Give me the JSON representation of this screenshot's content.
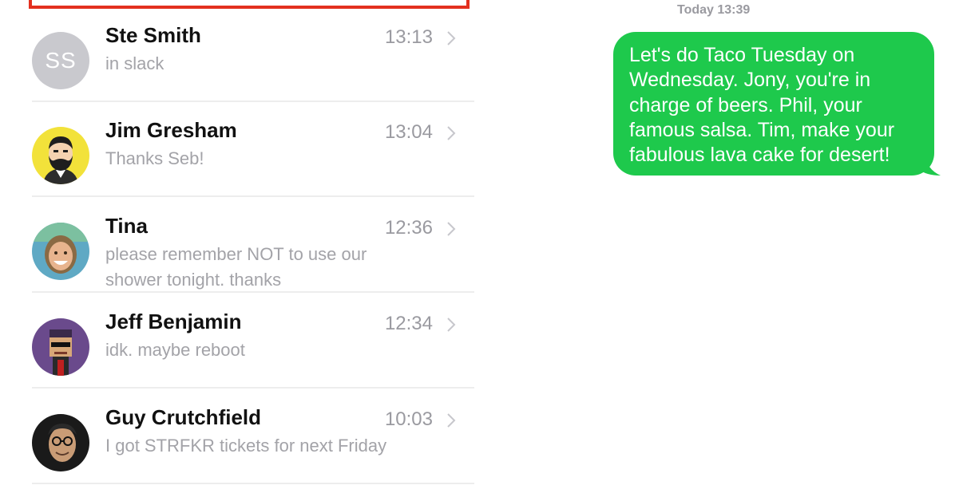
{
  "conversations": [
    {
      "name": "Ste Smith",
      "time": "13:13",
      "preview": "in slack",
      "avatar": {
        "type": "initials",
        "text": "SS",
        "color": "#c9c9ce"
      }
    },
    {
      "name": "Jim Gresham",
      "time": "13:04",
      "preview": "Thanks Seb!",
      "avatar": {
        "type": "cartoon",
        "icon": "bearded-man-cartoon",
        "bg": "#f2e23a"
      }
    },
    {
      "name": "Tina",
      "time": "12:36",
      "preview": "please remember NOT to use our shower tonight. thanks",
      "avatar": {
        "type": "photo",
        "icon": "smiling-woman-photo"
      }
    },
    {
      "name": "Jeff Benjamin",
      "time": "12:34",
      "preview": "idk. maybe reboot",
      "avatar": {
        "type": "pixel",
        "icon": "pixel-art-character",
        "bg": "#6a4a8c"
      }
    },
    {
      "name": "Guy Crutchfield",
      "time": "10:03",
      "preview": "I got STRFKR tickets for next Friday",
      "avatar": {
        "type": "photo",
        "icon": "man-glasses-photo"
      }
    }
  ],
  "thread": {
    "timestamp": "Today 13:39",
    "message": {
      "text": "Let's do Taco Tuesday on Wednesday. Jony, you're in charge of beers. Phil, your famous salsa. Tim, make your fabulous lava cake for desert!",
      "bubble_color": "#1ec94c"
    }
  },
  "colors": {
    "highlight": "#e3301f",
    "divider": "#ededed",
    "secondary_text": "#9a9aa0"
  }
}
